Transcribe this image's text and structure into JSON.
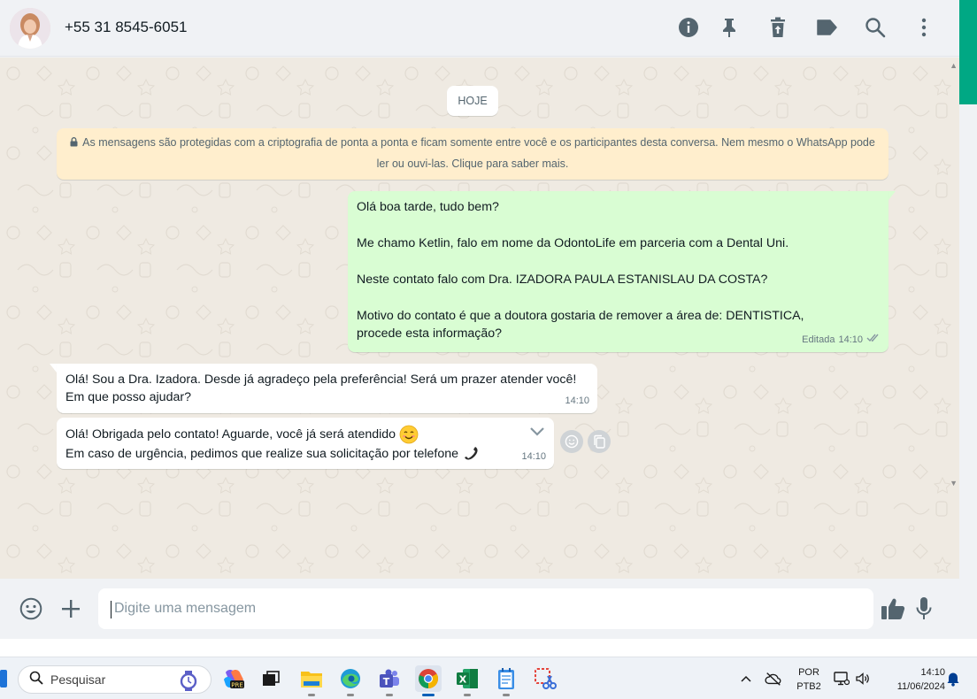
{
  "header": {
    "contact_name": "+55 31 8545-6051",
    "icons": [
      "info-icon",
      "pin-icon",
      "delete-icon",
      "label-icon",
      "search-icon",
      "menu-icon"
    ]
  },
  "chat": {
    "date_chip": "HOJE",
    "encryption_notice": "As mensagens são protegidas com a criptografia de ponta a ponta e ficam somente entre você e os participantes desta conversa. Nem mesmo o WhatsApp pode ler ou ouvi-las. Clique para saber mais.",
    "messages": [
      {
        "direction": "outgoing",
        "paragraphs": [
          "Olá boa tarde, tudo bem?",
          "Me chamo Ketlin, falo em nome da OdontoLife em parceria com a Dental Uni.",
          "Neste contato falo com Dra. IZADORA PAULA ESTANISLAU DA COSTA?",
          "Motivo do contato é que a doutora gostaria de remover a área de: DENTISTICA, procede esta informação?"
        ],
        "edited_label": "Editada",
        "time": "14:10",
        "status": "delivered"
      },
      {
        "direction": "incoming",
        "paragraphs": [
          "Olá! Sou a Dra. Izadora. Desde já agradeço pela preferência! Será um prazer atender você! Em que posso ajudar?"
        ],
        "time": "14:10"
      },
      {
        "direction": "incoming",
        "lines": [
          "Olá! Obrigada pelo contato! Aguarde, você já será atendido",
          "Em caso de urgência, pedimos que realize sua solicitação por telefone"
        ],
        "emojis": [
          "smiling-face-emoji",
          "telephone-receiver-emoji"
        ],
        "time": "14:10"
      }
    ]
  },
  "composer": {
    "placeholder": "Digite uma mensagem",
    "icons": [
      "emoji-icon",
      "attach-plus-icon",
      "thumbs-up-icon",
      "microphone-icon"
    ]
  },
  "taskbar": {
    "search_label": "Pesquisar",
    "apps": [
      "copilot-app",
      "taskview-app",
      "file-explorer-app",
      "edge-app",
      "teams-app",
      "chrome-app",
      "excel-app",
      "notepad-app",
      "snipping-tool-app"
    ],
    "language": "POR",
    "layout": "PTB2",
    "time": "14:10",
    "date": "11/06/2024"
  },
  "colors": {
    "accent": "#00a884",
    "outgoing_bubble": "#d9fdd3",
    "incoming_bubble": "#ffffff",
    "notice_bg": "#ffeecd",
    "chat_bg": "#efeae2",
    "read_tick": "#8696a0"
  }
}
